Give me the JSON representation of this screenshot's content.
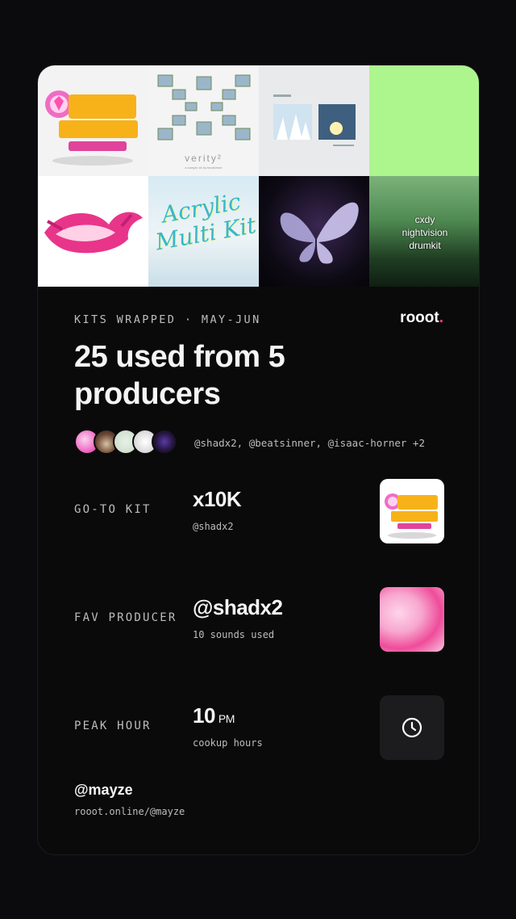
{
  "covers": [
    {
      "name": "x10K Multi Kit",
      "text": ""
    },
    {
      "name": "verity",
      "text": "verity²",
      "sub": "a sample kit by beatsinner"
    },
    {
      "name": "winter cover",
      "text": ""
    },
    {
      "name": "green cover",
      "text": ""
    },
    {
      "name": "pink chrome logo",
      "text": ""
    },
    {
      "name": "Acrylic Multi Kit",
      "text": "Acrylic Multi Kit"
    },
    {
      "name": "butterfly cover",
      "text": ""
    },
    {
      "name": "cxdy nightvision drumkit",
      "text": "cxdy\nnightvision\ndrumkit"
    }
  ],
  "eyebrow": "KITS WRAPPED · MAY-JUN",
  "brand": {
    "name": "rooot",
    "dot": "."
  },
  "headline": "25 used from 5 producers",
  "producers_line": "@shadx2, @beatsinner, @isaac-horner +2",
  "stats": {
    "goto": {
      "label": "GO-TO KIT",
      "value": "x10K",
      "sub": "@shadx2"
    },
    "fav": {
      "label": "FAV PRODUCER",
      "value": "@shadx2",
      "sub": "10 sounds used"
    },
    "peak": {
      "label": "PEAK HOUR",
      "value": "10",
      "unit": "PM",
      "sub": "cookup hours"
    }
  },
  "user": {
    "handle": "@mayze",
    "url": "rooot.online/@mayze"
  },
  "colors": {
    "accent_green": "#adf58d",
    "brand_dot": "#ff3f8a",
    "bg": "#0a0a0a"
  }
}
